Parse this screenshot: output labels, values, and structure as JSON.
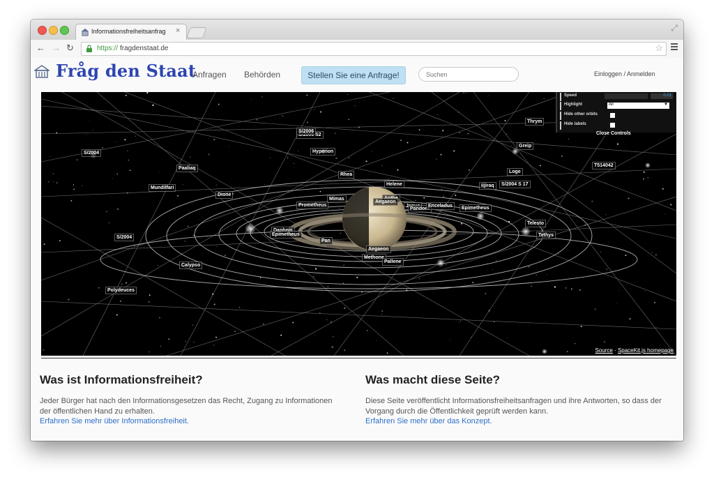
{
  "browser": {
    "tab_title": "Informationsfreiheitsanfrag",
    "tab_close": "×",
    "url_scheme": "https://",
    "url_rest": "fragdenstaat.de"
  },
  "header": {
    "logo": "Fråg den Staat",
    "nav": [
      "Anfragen",
      "Behörden"
    ],
    "cta": "Stellen Sie eine Anfrage!",
    "search_placeholder": "Suchen",
    "login": "Einloggen / Anmelden"
  },
  "viewer": {
    "planet": "Saturn",
    "moons": [
      "S/2004",
      "S/2006 S2",
      "Hyperion",
      "S/2006",
      "Paaliaq",
      "Rhea",
      "Helene",
      "Greip",
      "Loge",
      "T514042",
      "Mundilfari",
      "Dione",
      "Iijiraq",
      "S/2004 S 17",
      "Mimas",
      "Anthe",
      "Aegaeon",
      "Prometheus",
      "Janus",
      "Pandora",
      "Epimetheus",
      "Enceladus",
      "Daphnis",
      "Epimetheus",
      "Pan",
      "Telesto",
      "Tethys",
      "S/2004",
      "Aegaeon",
      "Methone",
      "Pallene",
      "Calypso",
      "Polydeuces",
      "Thrym"
    ],
    "controls": {
      "speed_label": "Speed",
      "speed_value": "0.01",
      "highlight_label": "Highlight",
      "highlight_value": "All",
      "hide_orbits_label": "Hide other orbits",
      "hide_labels_label": "Hide labels",
      "close_label": "Close Controls"
    },
    "source_link": "Source",
    "separator": " · ",
    "homepage_link": "SpaceKit.js homepage"
  },
  "sections": [
    {
      "title": "Was ist Informationsfreiheit?",
      "text": "Jeder Bürger hat nach den Informationsgesetzen das Recht, Zugang zu Informationen der öffentlichen Hand zu erhalten.",
      "link": "Erfahren Sie mehr über Informationsfreiheit."
    },
    {
      "title": "Was macht diese Seite?",
      "text": "Diese Seite veröffentlicht Informationsfreiheitsanfragen und ihre Antworten, so dass der Vorgang durch die Öffentlichkeit geprüft werden kann.",
      "link": "Erfahren Sie mehr über das Konzept."
    }
  ],
  "colors": {
    "logo": "#2d45b0",
    "cta_background": "#bfe0f2",
    "link": "#2d6fc9",
    "secure": "#3f9a3f"
  }
}
